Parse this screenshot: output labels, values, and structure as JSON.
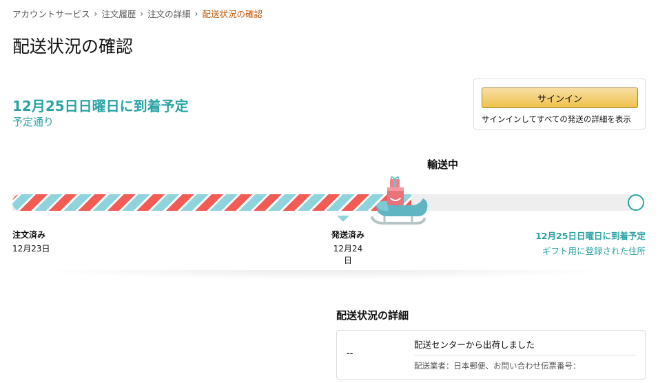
{
  "breadcrumb": {
    "items": [
      {
        "label": "アカウントサービス"
      },
      {
        "label": "注文履歴"
      },
      {
        "label": "注文の詳細"
      },
      {
        "label": "配送状況の確認"
      }
    ]
  },
  "page_title": "配送状況の確認",
  "arrival": {
    "headline": "12月25日日曜日に到着予定",
    "status": "予定通り"
  },
  "signin": {
    "button_label": "サインイン",
    "note": "サインインしてすべての発送の詳細を表示"
  },
  "tracker": {
    "current_status": "輸送中",
    "progress": 0.64,
    "shipped_marker_position": 0.53,
    "milestones": {
      "ordered": {
        "label": "注文済み",
        "date": "12月23日"
      },
      "shipped": {
        "label": "発送済み",
        "date": "12月24日"
      },
      "arrive": {
        "label": "12月25日日曜日に到着予定",
        "sub": "ギフト用に登録された住所"
      }
    }
  },
  "details": {
    "title": "配送状況の詳細",
    "time": "--",
    "message": "配送センターから出荷しました",
    "carrier": "配送業者：日本郵便、お問い合わせ伝票番号："
  },
  "colors": {
    "teal": "#2aa3a3",
    "link_current": "#c45500",
    "stripe_red": "#f25c54",
    "stripe_blue": "#8fd3dc",
    "button_yellow": "#f0c14b"
  },
  "icons": {
    "breadcrumb_separator": "chevron-right-icon",
    "tracker_vehicle": "sleigh-icon",
    "destination": "destination-circle-icon"
  }
}
